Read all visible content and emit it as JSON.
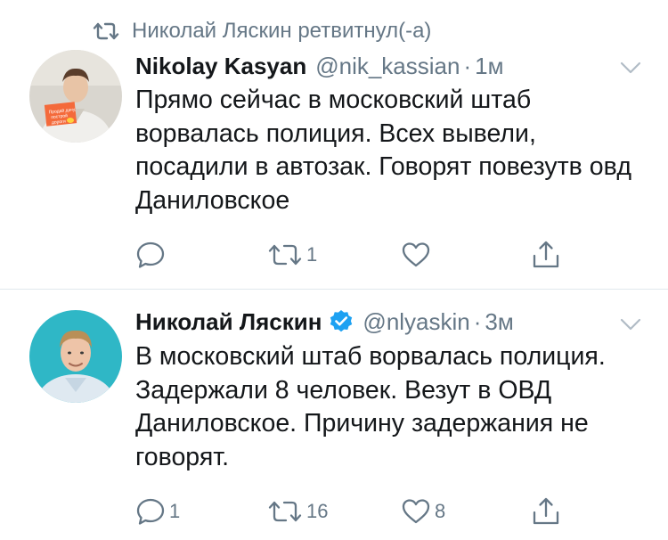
{
  "retweet_context": {
    "text": "Николай Ляскин ретвитнул(-а)",
    "icon": "retweet-icon"
  },
  "tweets": [
    {
      "name": "Nikolay Kasyan",
      "handle": "@nik_kassian",
      "dot": "·",
      "time": "1м",
      "verified": false,
      "text": "Прямо сейчас в московский штаб ворвалась полиция. Всех вывели, посадили в автозак. Говорят повезутв овд Даниловское",
      "replies": "",
      "retweets": "1",
      "likes": ""
    },
    {
      "name": "Николай Ляскин",
      "handle": "@nlyaskin",
      "dot": "·",
      "time": "3м",
      "verified": true,
      "text": "В московский штаб ворвалась полиция. Задержали 8 человек. Везут в ОВД Даниловское. Причину задержания не говорят.",
      "replies": "1",
      "retweets": "16",
      "likes": "8"
    }
  ],
  "colors": {
    "text": "#14171a",
    "secondary": "#657786",
    "verified": "#1da1f2",
    "divider": "#e1e8ed"
  }
}
